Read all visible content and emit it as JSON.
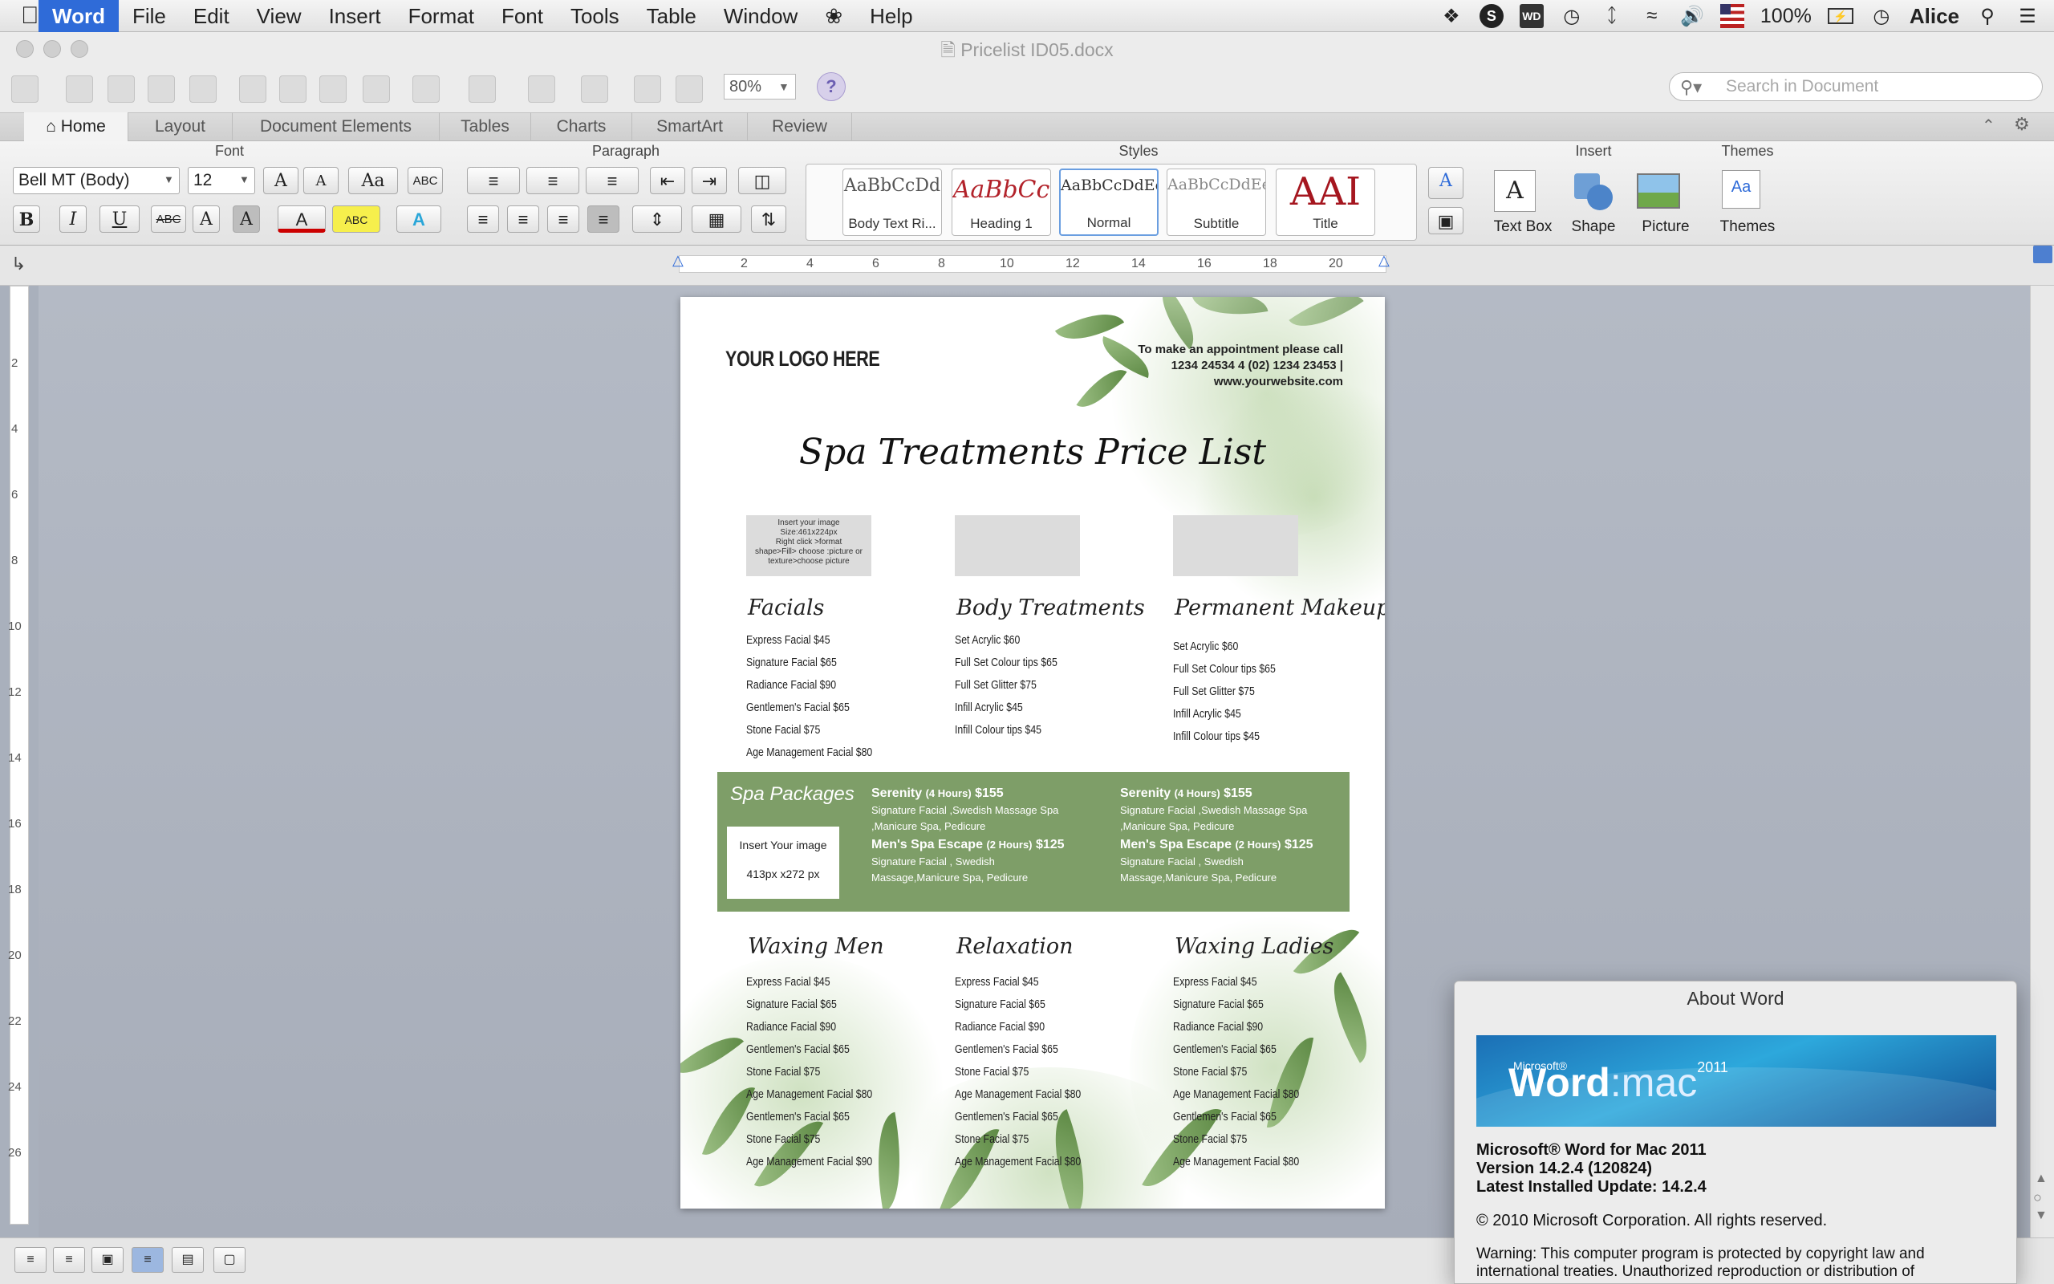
{
  "menubar": {
    "items": [
      "Word",
      "File",
      "Edit",
      "View",
      "Insert",
      "Format",
      "Font",
      "Tools",
      "Table",
      "Window",
      "Help"
    ],
    "user": "Alice",
    "battery": "100%"
  },
  "window": {
    "title": "Pricelist ID05.docx"
  },
  "toolbar": {
    "zoom": "80%",
    "search_placeholder": "Search in Document",
    "help": "?"
  },
  "ribbon": {
    "tabs": [
      "Home",
      "Layout",
      "Document Elements",
      "Tables",
      "Charts",
      "SmartArt",
      "Review"
    ],
    "groups": {
      "font": "Font",
      "paragraph": "Paragraph",
      "styles": "Styles",
      "insert": "Insert",
      "themes": "Themes"
    },
    "font_name": "Bell MT (Body)",
    "font_size": "12",
    "styles": [
      {
        "preview": "AaBbCcDd",
        "name": "Body Text Ri..."
      },
      {
        "preview": "AaBbCc",
        "name": "Heading 1"
      },
      {
        "preview": "AaBbCcDdEe",
        "name": "Normal"
      },
      {
        "preview": "AaBbCcDdEe",
        "name": "Subtitle"
      },
      {
        "preview": "AAI",
        "name": "Title"
      }
    ],
    "insert": {
      "text_box": "Text Box",
      "shape": "Shape",
      "picture": "Picture"
    },
    "themes": {
      "label": "Themes",
      "preview": "Aa"
    },
    "fmt": {
      "bold": "B",
      "italic": "I",
      "underline": "U",
      "strike": "ABC",
      "super": "A",
      "sub": "A",
      "grow": "A",
      "shrink": "A",
      "case": "Aa",
      "abc": "ABC"
    }
  },
  "ruler": {
    "h_labels": [
      "2",
      "4",
      "6",
      "8",
      "10",
      "12",
      "14",
      "16",
      "18",
      "20"
    ],
    "v_labels": [
      "2",
      "4",
      "6",
      "8",
      "10",
      "12",
      "14",
      "16",
      "18",
      "20",
      "22",
      "24",
      "26"
    ]
  },
  "document": {
    "logo": "YOUR LOGO HERE",
    "contact": [
      "To make an appointment please call",
      "1234 24534 4 (02) 1234 23453 |",
      "www.yourwebsite.com"
    ],
    "title": "Spa Treatments Price List",
    "image_hint": [
      "Insert your image",
      "Size:461x224px",
      "Right click >format",
      "shape>Fill> choose :picture or",
      "texture>choose picture"
    ],
    "columns": [
      {
        "heading": "Facials",
        "items": [
          "Express Facial $45",
          "Signature Facial $65",
          "Radiance Facial $90",
          "Gentlemen's Facial $65",
          "Stone Facial $75",
          "Age Management Facial $80"
        ]
      },
      {
        "heading": "Body Treatments",
        "items": [
          "Set Acrylic  $60",
          "Full Set Colour tips $65",
          "Full Set Glitter $75",
          "Infill Acrylic $45",
          "Infill Colour tips $45"
        ]
      },
      {
        "heading": "Permanent Makeup",
        "items": [
          "Set Acrylic  $60",
          "Full Set Colour tips $65",
          "Full Set Glitter $75",
          "Infill Acrylic $45",
          "Infill Colour tips $45"
        ]
      }
    ],
    "spa": {
      "heading": "Spa Packages",
      "image_label": "Insert Your image",
      "image_size": "413px x272 px",
      "packages": [
        {
          "title": "Serenity",
          "duration": "(4 Hours)",
          "price": "$155",
          "desc": [
            "Signature Facial ,Swedish Massage Spa",
            ",Manicure Spa, Pedicure"
          ]
        },
        {
          "title": "Men's Spa Escape",
          "duration": "(2 Hours)",
          "price": "$125",
          "desc": [
            "Signature Facial , Swedish",
            "Massage,Manicure Spa, Pedicure"
          ]
        },
        {
          "title": "Serenity",
          "duration": "(4 Hours)",
          "price": "$155",
          "desc": [
            "Signature Facial ,Swedish Massage Spa",
            ",Manicure Spa, Pedicure"
          ]
        },
        {
          "title": "Men's Spa Escape",
          "duration": "(2 Hours)",
          "price": "$125",
          "desc": [
            "Signature Facial , Swedish",
            "Massage,Manicure Spa, Pedicure"
          ]
        }
      ]
    },
    "bottom_columns": [
      {
        "heading": "Waxing Men",
        "items": [
          "Express Facial $45",
          "Signature Facial $65",
          "Radiance Facial $90",
          "Gentlemen's Facial $65",
          "Stone Facial $75",
          "Age Management Facial $80",
          "Gentlemen's Facial $65",
          "Stone Facial $75",
          "Age Management Facial $90"
        ]
      },
      {
        "heading": "Relaxation",
        "items": [
          "Express Facial $45",
          "Signature Facial $65",
          "Radiance Facial $90",
          "Gentlemen's Facial $65",
          "Stone Facial $75",
          "Age Management Facial $80",
          "Gentlemen's Facial $65",
          "Stone Facial $75",
          "Age Management Facial $80"
        ]
      },
      {
        "heading": "Waxing Ladies",
        "items": [
          "Express Facial $45",
          "Signature Facial $65",
          "Radiance Facial $90",
          "Gentlemen's Facial $65",
          "Stone Facial $75",
          "Age Management Facial $80",
          "Gentlemen's Facial $65",
          "Stone Facial $75",
          "Age Management Facial $80"
        ]
      }
    ]
  },
  "about": {
    "title": "About Word",
    "banner_brand": "Microsoft®",
    "banner_product": "Word",
    "banner_suffix": ":mac",
    "banner_year": "2011",
    "product": "Microsoft® Word for Mac 2011",
    "version": "Version 14.2.4 (120824)",
    "update": "Latest Installed Update: 14.2.4",
    "copyright": "© 2010 Microsoft Corporation. All rights reserved.",
    "warning1": "Warning: This computer program is protected by copyright law and",
    "warning2": "international treaties.  Unauthorized reproduction or distribution of"
  },
  "colors": {
    "accent": "#2f6bd8",
    "spa_green": "#7e9e68",
    "workspace": "#a9b0bc"
  }
}
